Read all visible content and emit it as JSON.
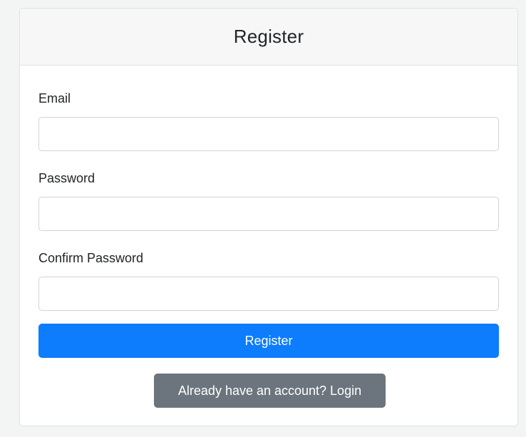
{
  "header": {
    "title": "Register"
  },
  "form": {
    "email": {
      "label": "Email",
      "value": "",
      "placeholder": ""
    },
    "password": {
      "label": "Password",
      "value": "",
      "placeholder": ""
    },
    "confirm_password": {
      "label": "Confirm Password",
      "value": "",
      "placeholder": ""
    }
  },
  "buttons": {
    "register_label": "Register",
    "login_link_label": "Already have an account? Login"
  },
  "colors": {
    "primary": "#0d7cfd",
    "secondary": "#6c757d",
    "header_bg": "#f7f7f7",
    "border": "#dfe1e3"
  }
}
